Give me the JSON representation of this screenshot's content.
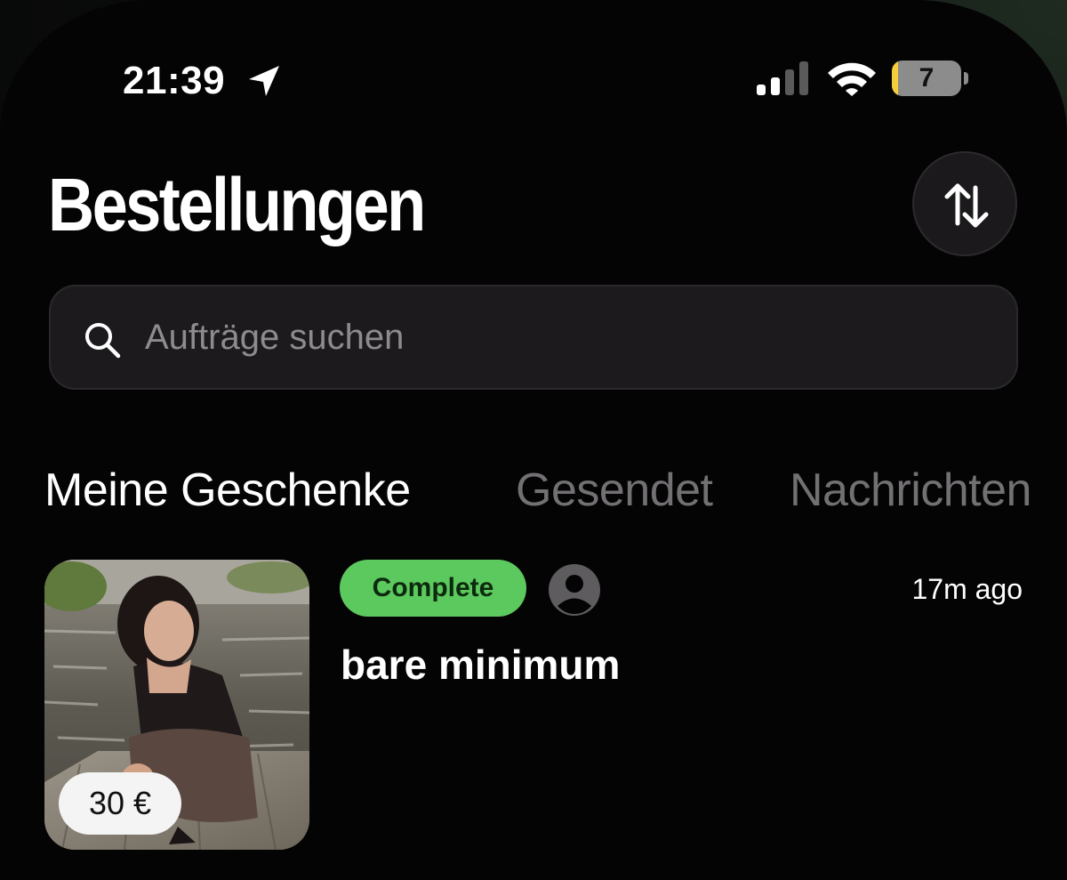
{
  "status_bar": {
    "time": "21:39",
    "battery_level": "7",
    "icons": [
      "location-arrow-icon",
      "cellular-signal-icon",
      "wifi-icon",
      "battery-icon"
    ]
  },
  "header": {
    "title": "Bestellungen",
    "sort_icon": "sort-arrows-icon"
  },
  "search": {
    "placeholder": "Aufträge suchen",
    "value": ""
  },
  "tabs": [
    {
      "label": "Meine Geschenke",
      "active": true
    },
    {
      "label": "Gesendet",
      "active": false
    },
    {
      "label": "Nachrichten",
      "active": false
    }
  ],
  "orders": [
    {
      "status": "Complete",
      "title": "bare minimum",
      "time_ago": "17m ago",
      "price": "30 €",
      "status_color": "#5cc95e"
    }
  ],
  "colors": {
    "background": "#050405",
    "accent_green": "#5cc95e",
    "inactive_tab": "#727072"
  }
}
